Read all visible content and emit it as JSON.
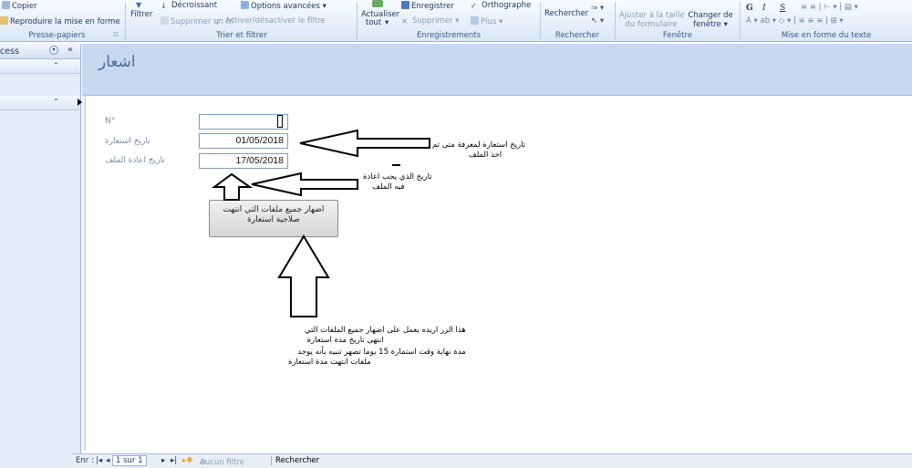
{
  "ribbon": {
    "clipboard": {
      "copy_label": "Copier",
      "format_painter_label": "Reproduire la mise en forme",
      "group_label": "Presse-papiers"
    },
    "sort_filter": {
      "filter_label": "Filtrer",
      "descending_label": "Décroissant",
      "remove_sort_label": "Supprimer un tri",
      "advanced_label": "Options avancées",
      "toggle_filter_label": "Activer/désactiver le filtre",
      "group_label": "Trier et filtrer"
    },
    "records": {
      "refresh_label": "Actualiser",
      "refresh_sub_label": "tout",
      "save_label": "Enregistrer",
      "spelling_label": "Orthographe",
      "delete_label": "Supprimer",
      "more_label": "Plus",
      "group_label": "Enregistrements"
    },
    "find": {
      "find_label": "Rechercher",
      "group_label": "Rechercher"
    },
    "window": {
      "fit_label_1": "Ajuster à la taille",
      "fit_label_2": "du formulaire",
      "switch_label_1": "Changer de",
      "switch_label_2": "fenêtre",
      "group_label": "Fenêtre"
    },
    "text_format": {
      "bold": "G",
      "italic": "I",
      "underline": "S",
      "group_label": "Mise en forme du texte"
    }
  },
  "nav_pane": {
    "header_label": "cess"
  },
  "form": {
    "title": "اشعار",
    "fields": [
      {
        "label": "N°",
        "value": ""
      },
      {
        "label": "تاريخ استعارة",
        "value": "01/05/2018"
      },
      {
        "label": "تاريخ اعادة الملف",
        "value": "17/05/2018"
      }
    ],
    "button_label_line1": "اضهار جميع ملفات التي انتهت",
    "button_label_line2": "صلاحية استعارة"
  },
  "annotations": {
    "note1_line1": "تاريخ استعارة  لمعرفة متى تم",
    "note1_line2": "اخذ الملف",
    "note2_line1": "تاريخ  الذي يجب اعادة",
    "note2_line2": "فيه الملف",
    "note3_line1": "هذا الزر اريده يعمل على اضهار جميع الملفات التي",
    "note3_line2": "انتهى تاريخ مدة استعارة",
    "note3_line3": "مدة نهاية وقت استمارة 15 يوما  تضهر تنبيه بأنه يوجد",
    "note3_line4": "ملفات انتهت مدة استعارة"
  },
  "record_nav": {
    "label": "Enr :",
    "position": "1 sur 1",
    "filter_label": "Aucun filtre",
    "search_label": "Rechercher"
  },
  "colors": {
    "title_band": "#c7d9f1",
    "ribbon": "#dbe7f6",
    "accent": "#1e395b"
  }
}
